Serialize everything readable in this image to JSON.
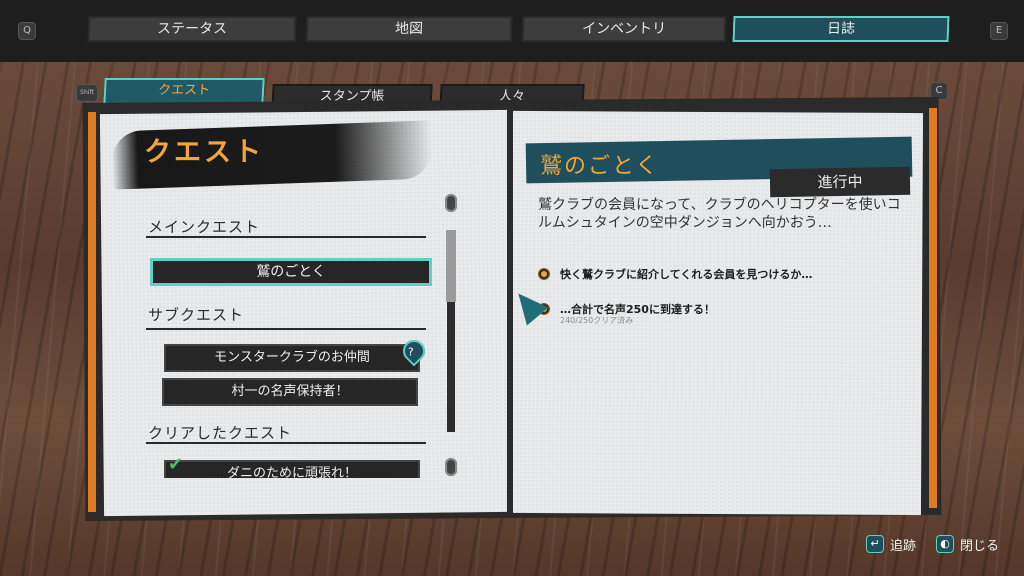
{
  "keys": {
    "prev_top": "Q",
    "next_top": "E",
    "prev_sub": "Shift",
    "next_sub": "C"
  },
  "nav_tabs": [
    {
      "label": "ステータス"
    },
    {
      "label": "地図"
    },
    {
      "label": "インベントリ"
    },
    {
      "label": "日誌"
    }
  ],
  "sub_tabs": [
    {
      "label": "クエスト"
    },
    {
      "label": "スタンプ帳"
    },
    {
      "label": "人々"
    }
  ],
  "left_page": {
    "title": "クエスト",
    "main_section": "メインクエスト",
    "main_quests": [
      {
        "label": "鷲のごとく"
      }
    ],
    "sub_section": "サブクエスト",
    "sub_quests": [
      {
        "label": "モンスタークラブのお仲間"
      },
      {
        "label": "村一の名声保持者！"
      }
    ],
    "cleared_section": "クリアしたクエスト",
    "cleared_quests": [
      {
        "label": "ダニのために頑張れ！"
      }
    ],
    "pin_glyph": "?"
  },
  "right_page": {
    "quest_title": "鷲のごとく",
    "status": "進行中",
    "description": "鷲クラブの会員になって、クラブのヘリコプターを使いコルムシュタインの空中ダンジョンへ向かおう…",
    "objectives": [
      {
        "text": "快く鷲クラブに紹介してくれる会員を見つけるか…",
        "sub": ""
      },
      {
        "text": "…合計で名声250に到達する！",
        "sub": "240/250クリア済み"
      }
    ]
  },
  "hints": [
    {
      "icon": "↵",
      "label": "追跡"
    },
    {
      "icon": "◐",
      "label": "閉じる"
    }
  ],
  "colors": {
    "accent": "#5fd1c4",
    "title": "#f2a53a",
    "banner": "#1f4e5c",
    "bookmark": "#e07a1e"
  }
}
